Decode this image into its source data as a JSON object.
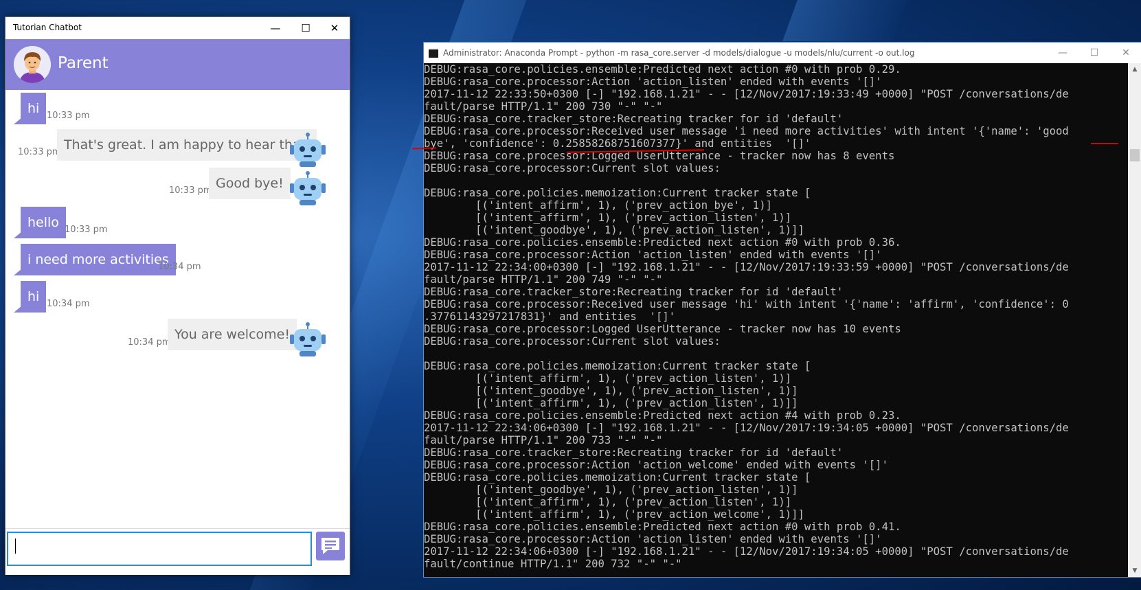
{
  "chat": {
    "window_title": "Tutorian Chatbot",
    "contact_name": "Parent",
    "input_value": "",
    "messages": [
      {
        "sender": "user",
        "text": "hi",
        "time": "10:33 pm"
      },
      {
        "sender": "bot",
        "text": "That's great. I am happy to hear that.",
        "time": "10:33 pm"
      },
      {
        "sender": "bot",
        "text": "Good bye!",
        "time": "10:33 pm"
      },
      {
        "sender": "user",
        "text": "hello",
        "time": "10:33 pm"
      },
      {
        "sender": "user",
        "text": "i need more activities",
        "time": "10:34 pm"
      },
      {
        "sender": "user",
        "text": "hi",
        "time": "10:34 pm"
      },
      {
        "sender": "bot",
        "text": "You are welcome!",
        "time": "10:34 pm"
      }
    ],
    "colors": {
      "accent": "#8883d8",
      "bot_bubble": "#efefef",
      "input_border": "#1e90e0"
    },
    "icons": {
      "minimize": "minimize-icon",
      "maximize": "maximize-icon",
      "close": "close-icon",
      "send": "send-message-icon"
    }
  },
  "console": {
    "window_title": "Administrator: Anaconda Prompt - python  -m rasa_core.server -d models/dialogue -u models/nlu/current -o out.log",
    "lines": [
      "DEBUG:rasa_core.policies.ensemble:Predicted next action #0 with prob 0.29.",
      "DEBUG:rasa_core.processor:Action 'action_listen' ended with events '[]'",
      "2017-11-12 22:33:50+0300 [-] \"192.168.1.21\" - - [12/Nov/2017:19:33:49 +0000] \"POST /conversations/de",
      "fault/parse HTTP/1.1\" 200 730 \"-\" \"-\"",
      "DEBUG:rasa_core.tracker_store:Recreating tracker for id 'default'",
      "DEBUG:rasa_core.processor:Received user message 'i need more activities' with intent '{'name': 'good",
      "bye', 'confidence': 0.25858268751607377}' and entities  '[]'",
      "DEBUG:rasa_core.processor:Logged UserUtterance - tracker now has 8 events",
      "DEBUG:rasa_core.processor:Current slot values:",
      "",
      "DEBUG:rasa_core.policies.memoization:Current tracker state [",
      "        [('intent_affirm', 1), ('prev_action_bye', 1)]",
      "        [('intent_affirm', 1), ('prev_action_listen', 1)]",
      "        [('intent_goodbye', 1), ('prev_action_listen', 1)]]",
      "DEBUG:rasa_core.policies.ensemble:Predicted next action #0 with prob 0.36.",
      "DEBUG:rasa_core.processor:Action 'action_listen' ended with events '[]'",
      "2017-11-12 22:34:00+0300 [-] \"192.168.1.21\" - - [12/Nov/2017:19:33:59 +0000] \"POST /conversations/de",
      "fault/parse HTTP/1.1\" 200 749 \"-\" \"-\"",
      "DEBUG:rasa_core.tracker_store:Recreating tracker for id 'default'",
      "DEBUG:rasa_core.processor:Received user message 'hi' with intent '{'name': 'affirm', 'confidence': 0",
      ".37761143297217831}' and entities  '[]'",
      "DEBUG:rasa_core.processor:Logged UserUtterance - tracker now has 10 events",
      "DEBUG:rasa_core.processor:Current slot values:",
      "",
      "DEBUG:rasa_core.policies.memoization:Current tracker state [",
      "        [('intent_affirm', 1), ('prev_action_listen', 1)]",
      "        [('intent_goodbye', 1), ('prev_action_listen', 1)]",
      "        [('intent_affirm', 1), ('prev_action_listen', 1)]]",
      "DEBUG:rasa_core.policies.ensemble:Predicted next action #4 with prob 0.23.",
      "2017-11-12 22:34:06+0300 [-] \"192.168.1.21\" - - [12/Nov/2017:19:34:05 +0000] \"POST /conversations/de",
      "fault/parse HTTP/1.1\" 200 733 \"-\" \"-\"",
      "DEBUG:rasa_core.tracker_store:Recreating tracker for id 'default'",
      "DEBUG:rasa_core.processor:Action 'action_welcome' ended with events '[]'",
      "DEBUG:rasa_core.policies.memoization:Current tracker state [",
      "        [('intent_goodbye', 1), ('prev_action_listen', 1)]",
      "        [('intent_affirm', 1), ('prev_action_listen', 1)]",
      "        [('intent_affirm', 1), ('prev_action_welcome', 1)]]",
      "DEBUG:rasa_core.policies.ensemble:Predicted next action #0 with prob 0.41.",
      "DEBUG:rasa_core.processor:Action 'action_listen' ended with events '[]'",
      "2017-11-12 22:34:06+0300 [-] \"192.168.1.21\" - - [12/Nov/2017:19:34:05 +0000] \"POST /conversations/de",
      "fault/continue HTTP/1.1\" 200 732 \"-\" \"-\""
    ],
    "colors": {
      "background": "#0c0c0c",
      "text": "#c0c0c0",
      "highlight_mark": "#dd0000"
    },
    "icons": {
      "app": "console-icon",
      "minimize": "minimize-icon",
      "maximize": "maximize-icon",
      "close": "close-icon"
    }
  }
}
